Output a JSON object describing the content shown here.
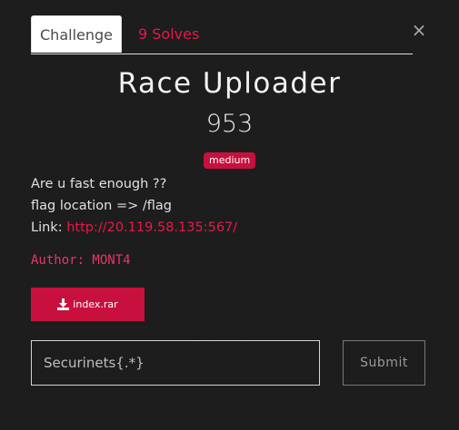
{
  "tabs": {
    "challenge": "Challenge",
    "solves": "9 Solves"
  },
  "close_glyph": "×",
  "challenge": {
    "name": "Race Uploader",
    "value": "953",
    "difficulty": "medium",
    "description": {
      "line1": "Are u fast enough ??",
      "line2_label": "flag location => ",
      "line2_value": "/flag",
      "line3_label": "Link: ",
      "link": "http://20.119.58.135:567/"
    },
    "author": "Author: MONT4",
    "file": {
      "name": "index.rar",
      "icon": "download-icon"
    }
  },
  "flag_form": {
    "placeholder": "Securinets{.*}",
    "submit_label": "Submit"
  },
  "colors": {
    "accent": "#e6194b",
    "badge": "#c8103e",
    "background": "#1d1d1d"
  }
}
